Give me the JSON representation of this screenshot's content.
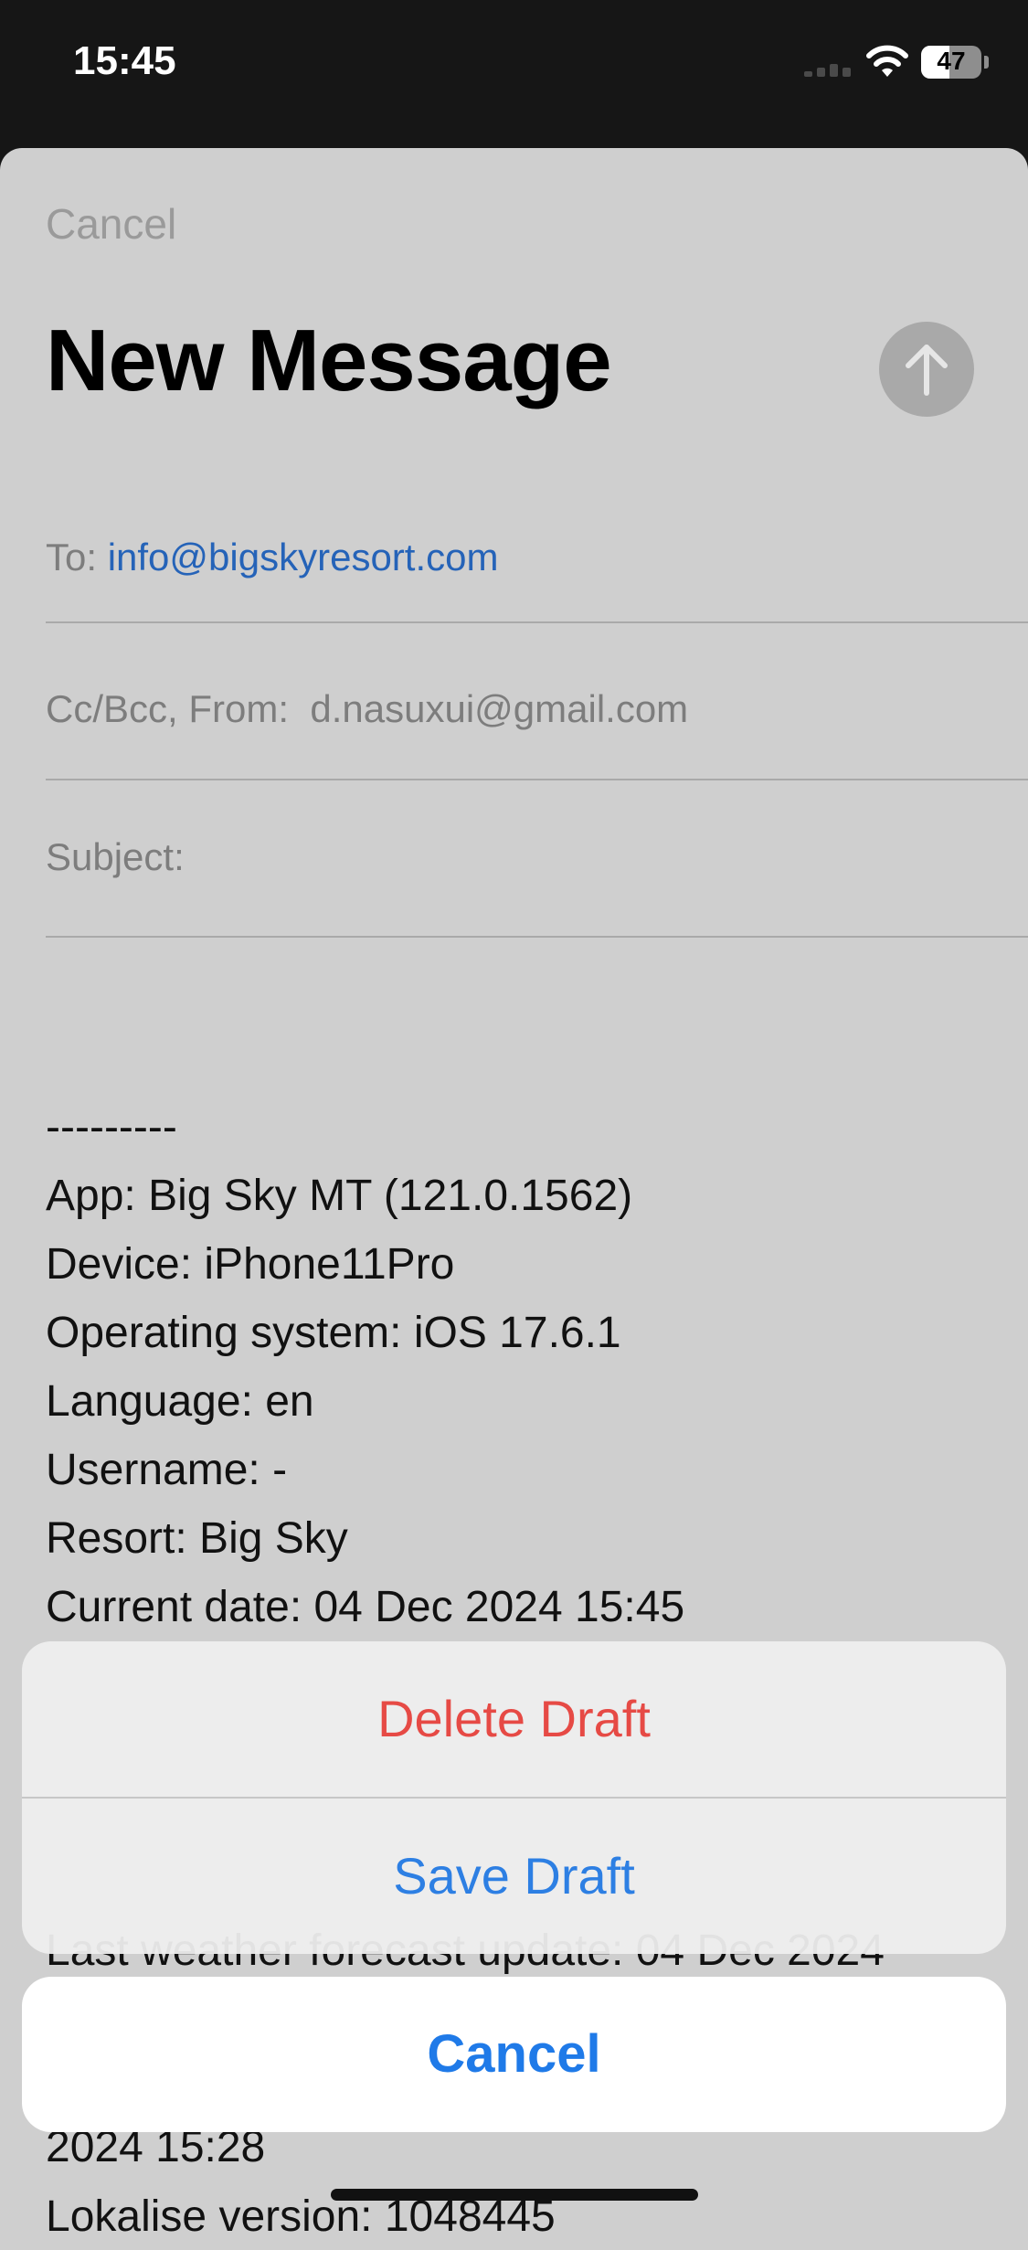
{
  "status_bar": {
    "time": "15:45",
    "battery_level": "47",
    "battery_fraction": 0.47
  },
  "compose": {
    "cancel_label": "Cancel",
    "title": "New Message",
    "to_label": "To:",
    "to_value": "info@bigskyresort.com",
    "ccbcc_label": "Cc/Bcc, From:",
    "from_value": "d.nasuxui@gmail.com",
    "subject_label": "Subject:",
    "body_lines": [
      "---------",
      "App: Big Sky MT (121.0.1562)",
      "Device: iPhone11Pro",
      "Operating system: iOS 17.6.1",
      "Language: en",
      "Username: -",
      "Resort: Big Sky",
      "Current date: 04 Dec 2024 15:45"
    ],
    "partially_hidden_line": "Last weather forecast update: 04 Dec 2024",
    "below_lines": [
      "2024 15:28",
      "Lokalise version: 1048445"
    ]
  },
  "action_sheet": {
    "delete_label": "Delete Draft",
    "save_label": "Save Draft",
    "cancel_label": "Cancel"
  },
  "colors": {
    "accent": "#1f7ae8",
    "destructive": "#e64a45",
    "link": "#2563b8"
  },
  "icons": {
    "send": "arrow-up-icon",
    "wifi": "wifi-icon",
    "signal": "cellular-signal-icon",
    "battery": "battery-icon"
  }
}
